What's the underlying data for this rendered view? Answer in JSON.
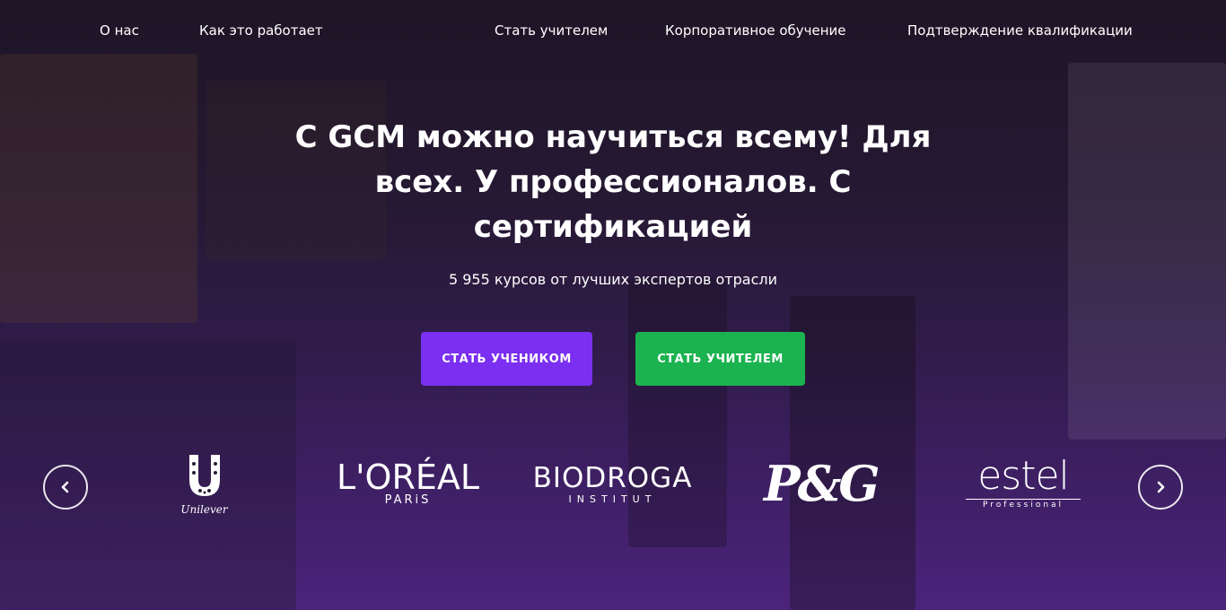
{
  "nav": {
    "about": "О нас",
    "how_it_works": "Как это работает",
    "become_teacher": "Стать учителем",
    "corporate": "Корпоративное обучение",
    "qualification": "Подтверждение квалификации"
  },
  "hero": {
    "title": "С GCM можно научиться всему! Для всех. У профессионалов. С сертификацией",
    "subtitle": "5 955 курсов от лучших экспертов отрасли",
    "btn_student": "СТАТЬ УЧЕНИКОМ",
    "btn_teacher": "СТАТЬ УЧИТЕЛЕМ"
  },
  "colors": {
    "student_button": "#7b2ff0",
    "teacher_button": "#1bb34f"
  },
  "partners": {
    "prev_icon": "chevron-left-icon",
    "next_icon": "chevron-right-icon",
    "unilever": "Unilever",
    "loreal": "L'ORÉAL",
    "loreal_sub": "PARiS",
    "biodroga": "BIODROGA",
    "biodroga_sub": "INSTITUT",
    "pg": "P&G",
    "estel": "estel",
    "estel_sub": "Professional"
  }
}
